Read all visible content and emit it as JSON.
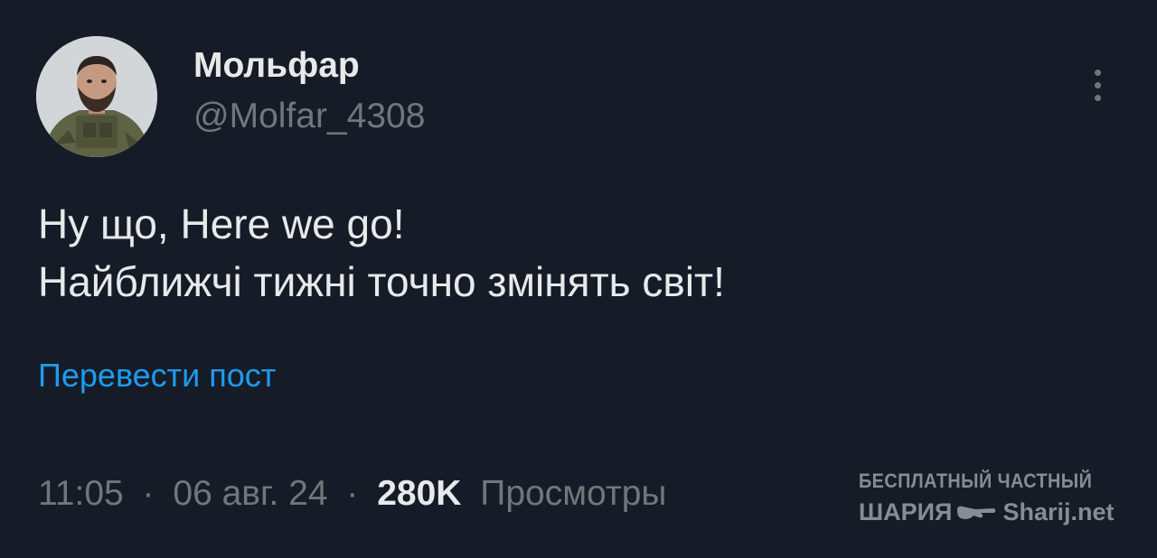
{
  "author": {
    "display_name": "Мольфар",
    "handle": "@Molfar_4308",
    "avatar_icon": "profile-photo-soldier"
  },
  "tweet": {
    "lines": [
      "Ну що, Here we go!",
      "Найближчі тижні точно змінять світ!"
    ],
    "translate_label": "Перевести пост",
    "time": "11:05",
    "separator": "·",
    "date": "06 авг. 24",
    "views_count": "280K",
    "views_label": "Просмотры"
  },
  "more_icon": "more-vertical-icon",
  "watermark": {
    "line1": "БЕСПЛАТНЫЙ ЧАСТНЫЙ",
    "left": "ШАРИЯ",
    "right": "Sharij.net",
    "hand_icon": "pointing-hand-icon"
  },
  "colors": {
    "background": "#161c27",
    "text_primary": "#e7e9ea",
    "text_secondary": "#71767b",
    "link": "#1d9bf0"
  }
}
